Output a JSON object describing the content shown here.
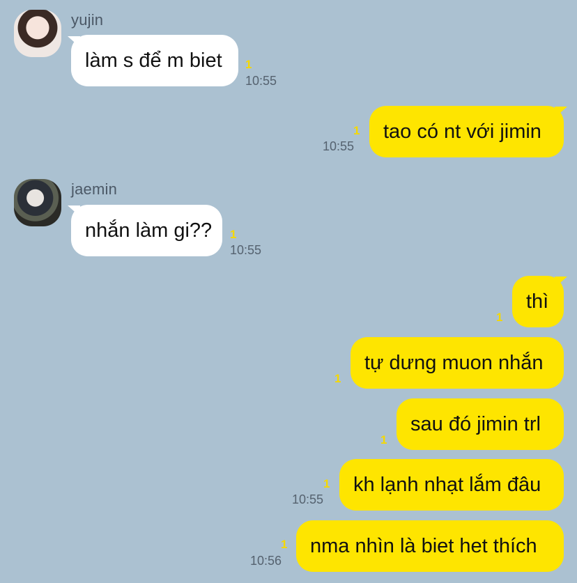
{
  "chat": {
    "senders": {
      "yujin": "yujin",
      "jaemin": "jaemin"
    },
    "messages": [
      {
        "text": "làm s để m biet",
        "unread": "1",
        "time": "10:55"
      },
      {
        "text": "tao có nt với jimin",
        "unread": "1",
        "time": "10:55"
      },
      {
        "text": "nhắn làm gi??",
        "unread": "1",
        "time": "10:55"
      },
      {
        "text": "thì",
        "unread": "1"
      },
      {
        "text": "tự dưng muon nhắn",
        "unread": "1"
      },
      {
        "text": "sau đó jimin trl",
        "unread": "1"
      },
      {
        "text": "kh lạnh nhạt lắm đâu",
        "unread": "1",
        "time": "10:55"
      },
      {
        "text": "nma nhìn là biet het thích",
        "unread": "1",
        "time": "10:56"
      }
    ]
  },
  "colors": {
    "background": "#abc1d1",
    "incoming_bubble": "#ffffff",
    "outgoing_bubble": "#fee500",
    "unread_count": "#f5d800"
  },
  "icons": [
    "avatar-yujin",
    "avatar-jaemin"
  ]
}
